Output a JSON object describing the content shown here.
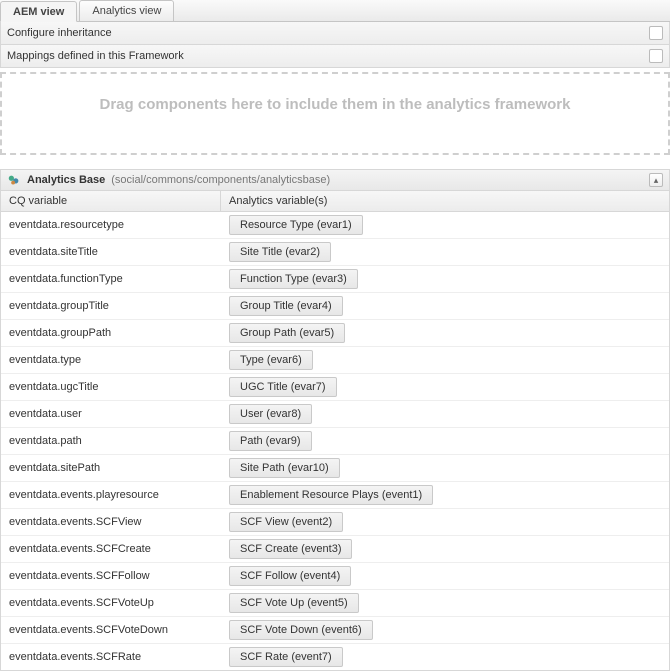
{
  "tabs": [
    {
      "label": "AEM view",
      "active": true
    },
    {
      "label": "Analytics view",
      "active": false
    }
  ],
  "panels": {
    "configure": {
      "label": "Configure inheritance"
    },
    "mappings": {
      "label": "Mappings defined in this Framework"
    }
  },
  "dropzone": {
    "text": "Drag components here to include them in the analytics framework"
  },
  "section": {
    "title": "Analytics Base",
    "path": "(social/commons/components/analyticsbase)"
  },
  "table": {
    "headers": {
      "cq": "CQ variable",
      "av": "Analytics variable(s)"
    },
    "rows": [
      {
        "cq": "eventdata.resourcetype",
        "av": "Resource Type (evar1)"
      },
      {
        "cq": "eventdata.siteTitle",
        "av": "Site Title (evar2)"
      },
      {
        "cq": "eventdata.functionType",
        "av": "Function Type (evar3)"
      },
      {
        "cq": "eventdata.groupTitle",
        "av": "Group Title (evar4)"
      },
      {
        "cq": "eventdata.groupPath",
        "av": "Group Path (evar5)"
      },
      {
        "cq": "eventdata.type",
        "av": "Type (evar6)"
      },
      {
        "cq": "eventdata.ugcTitle",
        "av": "UGC Title (evar7)"
      },
      {
        "cq": "eventdata.user",
        "av": "User (evar8)"
      },
      {
        "cq": "eventdata.path",
        "av": "Path (evar9)"
      },
      {
        "cq": "eventdata.sitePath",
        "av": "Site Path (evar10)"
      },
      {
        "cq": "eventdata.events.playresource",
        "av": "Enablement Resource Plays (event1)"
      },
      {
        "cq": "eventdata.events.SCFView",
        "av": "SCF View (event2)"
      },
      {
        "cq": "eventdata.events.SCFCreate",
        "av": "SCF Create (event3)"
      },
      {
        "cq": "eventdata.events.SCFFollow",
        "av": "SCF Follow (event4)"
      },
      {
        "cq": "eventdata.events.SCFVoteUp",
        "av": "SCF Vote Up (event5)"
      },
      {
        "cq": "eventdata.events.SCFVoteDown",
        "av": "SCF Vote Down (event6)"
      },
      {
        "cq": "eventdata.events.SCFRate",
        "av": "SCF Rate (event7)"
      }
    ]
  }
}
